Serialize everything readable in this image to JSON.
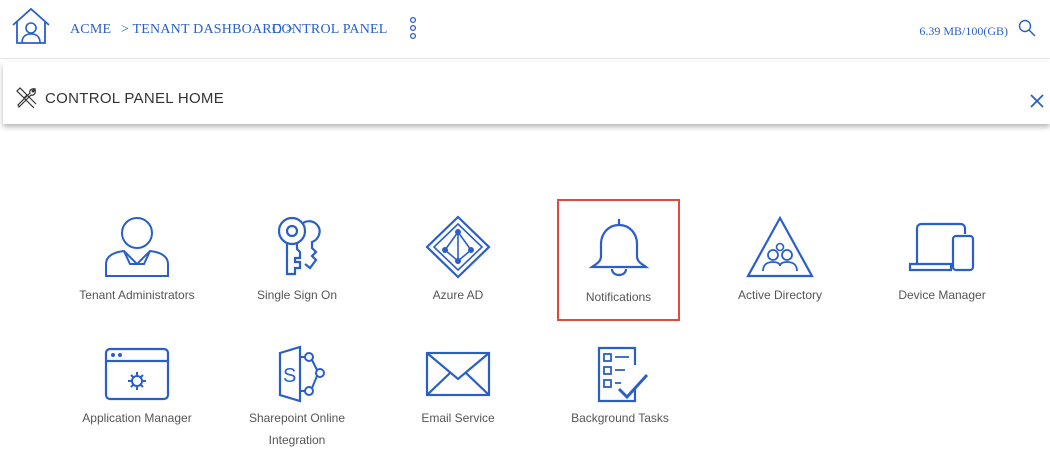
{
  "header": {
    "breadcrumbs": [
      "ACME",
      "> TENANT DASHBOARD >",
      "CONTROL PANEL"
    ],
    "storage": "6.39 MB/100(GB)"
  },
  "panel": {
    "title": "CONTROL PANEL HOME"
  },
  "tiles": [
    {
      "label": "Tenant Administrators",
      "icon": "user-admin-icon"
    },
    {
      "label": "Single Sign On",
      "icon": "keys-icon"
    },
    {
      "label": "Azure AD",
      "icon": "azure-ad-icon"
    },
    {
      "label": "Notifications",
      "icon": "bell-icon",
      "selected": true
    },
    {
      "label": "Active Directory",
      "icon": "active-directory-icon"
    },
    {
      "label": "Device Manager",
      "icon": "devices-icon"
    },
    {
      "label": "Application Manager",
      "icon": "app-window-gear-icon"
    },
    {
      "label": "Sharepoint Online Integration",
      "icon": "sharepoint-icon"
    },
    {
      "label": "Email Service",
      "icon": "envelope-icon"
    },
    {
      "label": "Background Tasks",
      "icon": "checklist-icon"
    }
  ],
  "colors": {
    "accent": "#2a5fc9",
    "selection_border": "#e04a3f"
  }
}
